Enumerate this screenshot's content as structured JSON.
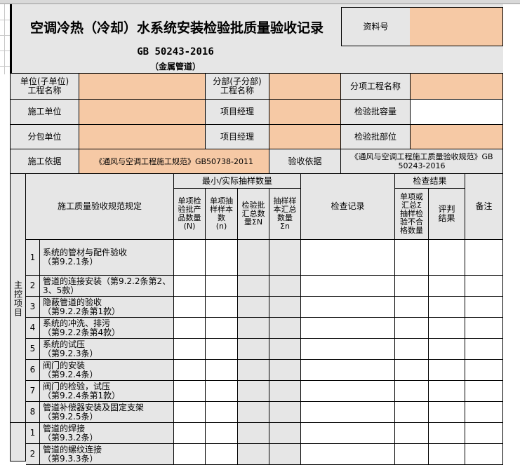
{
  "header": {
    "title": "空调冷热（冷却）水系统安装检验批质量验收记录",
    "standard": "GB 50243-2016",
    "subtitle": "（金属管道）",
    "doc_no_label": "资料号"
  },
  "info": {
    "unit_label": "单位(子单位)\n工程名称",
    "subdivision_label": "分部(子分部)\n工程名称",
    "item_label": "分项工程名称",
    "builder_label": "施工单位",
    "pm_label": "项目经理",
    "capacity_label": "检验批容量",
    "subcontractor_label": "分包单位",
    "pm2_label": "项目经理",
    "location_label": "检验批部位",
    "basis_label": "施工依据",
    "basis_value": "《通风与空调工程施工规范》GB50738-2011",
    "acceptance_basis_label": "验收依据",
    "acceptance_basis_value": "《通风与空调工程施工质量验收规范》GB 50243-2016"
  },
  "table": {
    "spec_header": "施工质量验收规范规定",
    "sampling_header": "最小/实际抽样数量",
    "col_n": "单项检\n验批产\n品数量\n(N)",
    "col_small_n": "单项抽\n样样本\n数\n(n)",
    "col_sum_N": "检验批\n汇总数\n量ΣN",
    "col_sum_n": "抽样样\n本汇总\n数量\nΣn",
    "record_header": "检查记录",
    "result_header": "检查结果",
    "col_unqualified": "单项或\n汇总Σ\n抽样检\n验不合\n格数量",
    "col_judge": "评判\n结果",
    "remark_header": "备注",
    "main_control_label": "主控项目",
    "main_rows": [
      {
        "no": "1",
        "text": "系统的管材与配件验收\n（第9.2.1条）"
      },
      {
        "no": "2",
        "text": "管道的连接安装（第9.2.2条第2、3、5款）"
      },
      {
        "no": "3",
        "text": "隐蔽管道的验收\n（第9.2.2条第1款）"
      },
      {
        "no": "4",
        "text": "系统的冲洗、排污\n（第9.2.2条第4款）"
      },
      {
        "no": "5",
        "text": "系统的试压\n（第9.2.3条）"
      },
      {
        "no": "6",
        "text": "阀门的安装\n（第9.2.4条）"
      },
      {
        "no": "7",
        "text": "阀门的检验，试压\n（第9.2.4条第1款）"
      },
      {
        "no": "8",
        "text": "管道补偿器安装及固定支架\n（第9.2.5条）"
      }
    ],
    "general_rows": [
      {
        "no": "1",
        "text": "管道的焊接\n（第9.3.2条）"
      },
      {
        "no": "2",
        "text": "管道的螺纹连接\n（第9.3.3条）"
      }
    ]
  }
}
